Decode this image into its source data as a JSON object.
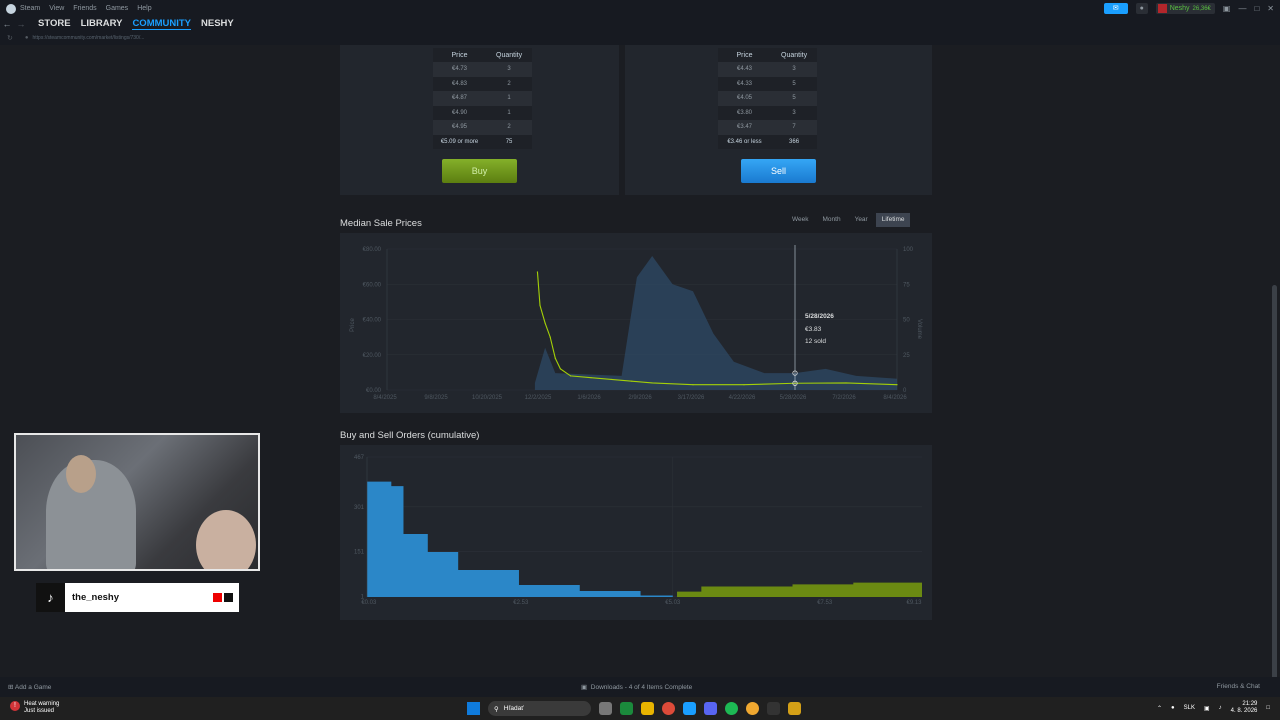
{
  "titlebar": {
    "menu": [
      "Steam",
      "View",
      "Friends",
      "Games",
      "Help"
    ],
    "username": "Neshy",
    "wallet": "26,36€"
  },
  "nav": {
    "links": [
      "STORE",
      "LIBRARY",
      "COMMUNITY",
      "NESHY"
    ],
    "active": "COMMUNITY",
    "url": "https://steamcommunity.com/market/listings/730/..."
  },
  "buy_orders": {
    "headers": [
      "Price",
      "Quantity"
    ],
    "rows": [
      {
        "price": "€4.73",
        "qty": "3"
      },
      {
        "price": "€4.83",
        "qty": "2"
      },
      {
        "price": "€4.87",
        "qty": "1"
      },
      {
        "price": "€4.90",
        "qty": "1"
      },
      {
        "price": "€4.95",
        "qty": "2"
      },
      {
        "price": "€5.09 or more",
        "qty": "75"
      }
    ],
    "button": "Buy"
  },
  "sell_orders": {
    "headers": [
      "Price",
      "Quantity"
    ],
    "rows": [
      {
        "price": "€4.43",
        "qty": "3"
      },
      {
        "price": "€4.33",
        "qty": "5"
      },
      {
        "price": "€4.05",
        "qty": "5"
      },
      {
        "price": "€3.80",
        "qty": "3"
      },
      {
        "price": "€3.47",
        "qty": "7"
      },
      {
        "price": "€3.46 or less",
        "qty": "366"
      }
    ],
    "button": "Sell"
  },
  "median": {
    "title": "Median Sale Prices",
    "ranges": [
      "Week",
      "Month",
      "Year",
      "Lifetime"
    ],
    "active_range": "Lifetime",
    "tooltip": {
      "date": "5/28/2026",
      "price": "€3.83",
      "sold": "12 sold"
    }
  },
  "orders_chart": {
    "title": "Buy and Sell Orders (cumulative)"
  },
  "chart_data": [
    {
      "type": "line",
      "x_ticks": [
        "8/4/2025",
        "9/8/2025",
        "10/20/2025",
        "12/2/2025",
        "1/6/2026",
        "2/9/2026",
        "3/17/2026",
        "4/22/2026",
        "5/28/2026",
        "7/2/2026",
        "8/4/2026"
      ],
      "y_ticks": [
        "€0.00",
        "€20.00",
        "€40.00",
        "€60.00",
        "€80.00"
      ],
      "y2_ticks": [
        "0",
        "25",
        "50",
        "75",
        "100"
      ],
      "ylabel": "Price",
      "y2label": "Volume",
      "ylim": [
        0,
        80
      ],
      "y2lim": [
        0,
        100
      ],
      "price_series": [
        {
          "x": 0.295,
          "y": 67
        },
        {
          "x": 0.3,
          "y": 48
        },
        {
          "x": 0.31,
          "y": 38
        },
        {
          "x": 0.32,
          "y": 30
        },
        {
          "x": 0.33,
          "y": 18
        },
        {
          "x": 0.34,
          "y": 12
        },
        {
          "x": 0.36,
          "y": 8
        },
        {
          "x": 0.4,
          "y": 7
        },
        {
          "x": 0.44,
          "y": 6
        },
        {
          "x": 0.48,
          "y": 5
        },
        {
          "x": 0.52,
          "y": 4
        },
        {
          "x": 0.6,
          "y": 3
        },
        {
          "x": 0.7,
          "y": 3
        },
        {
          "x": 0.8,
          "y": 3.83
        },
        {
          "x": 0.9,
          "y": 4
        },
        {
          "x": 1.0,
          "y": 3
        }
      ],
      "volume_series": [
        {
          "x": 0.29,
          "y": 5
        },
        {
          "x": 0.31,
          "y": 30
        },
        {
          "x": 0.33,
          "y": 12
        },
        {
          "x": 0.46,
          "y": 10
        },
        {
          "x": 0.49,
          "y": 80
        },
        {
          "x": 0.52,
          "y": 95
        },
        {
          "x": 0.56,
          "y": 75
        },
        {
          "x": 0.6,
          "y": 70
        },
        {
          "x": 0.64,
          "y": 40
        },
        {
          "x": 0.68,
          "y": 20
        },
        {
          "x": 0.74,
          "y": 12
        },
        {
          "x": 0.8,
          "y": 12
        },
        {
          "x": 0.86,
          "y": 15
        },
        {
          "x": 0.92,
          "y": 10
        },
        {
          "x": 1.0,
          "y": 8
        }
      ]
    },
    {
      "type": "area",
      "x_ticks": [
        "€0.03",
        "€2.53",
        "€5.03",
        "€7.53",
        "€9.13"
      ],
      "y_ticks": [
        "1",
        "151",
        "301",
        "467"
      ],
      "ylim": [
        0,
        467
      ],
      "xlim": [
        0,
        9.13
      ],
      "buy_series": [
        {
          "x": 0.0,
          "y": 385
        },
        {
          "x": 0.4,
          "y": 370
        },
        {
          "x": 0.6,
          "y": 210
        },
        {
          "x": 1.0,
          "y": 150
        },
        {
          "x": 1.5,
          "y": 90
        },
        {
          "x": 2.5,
          "y": 40
        },
        {
          "x": 3.5,
          "y": 20
        },
        {
          "x": 4.5,
          "y": 5
        },
        {
          "x": 5.03,
          "y": 0
        }
      ],
      "sell_series": [
        {
          "x": 4.6,
          "y": 0
        },
        {
          "x": 5.1,
          "y": 18
        },
        {
          "x": 5.5,
          "y": 35
        },
        {
          "x": 7.0,
          "y": 42
        },
        {
          "x": 8.0,
          "y": 48
        },
        {
          "x": 9.13,
          "y": 52
        }
      ]
    }
  ],
  "overlay": {
    "handle": "the_neshy"
  },
  "bottombar": {
    "add_game": "Add a Game",
    "downloads": "Downloads - 4 of 4 Items Complete",
    "friends": "Friends & Chat"
  },
  "taskbar": {
    "warning_title": "Heat warning",
    "warning_sub": "Just issued",
    "search": "Hľadať",
    "lang": "SLK",
    "time": "21:29",
    "date": "4. 8. 2026"
  }
}
